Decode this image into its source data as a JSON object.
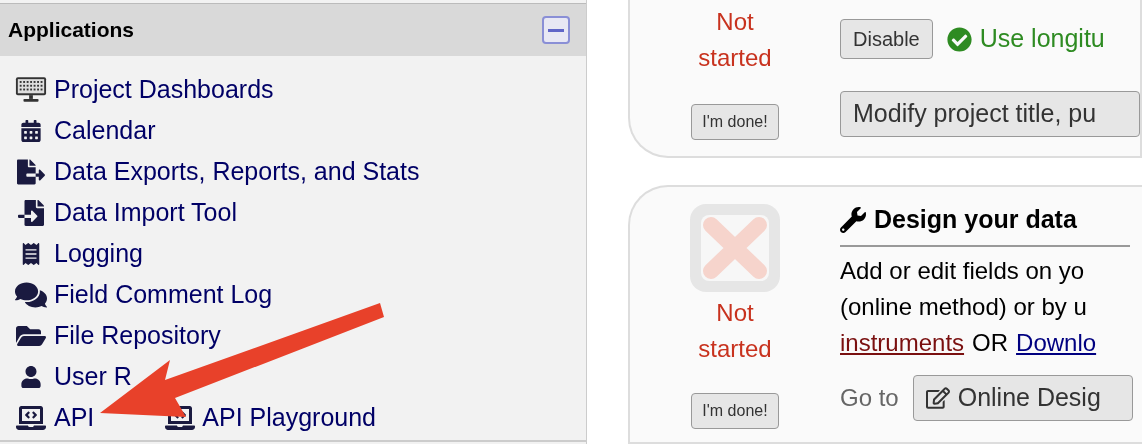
{
  "sidebar": {
    "title": "Applications",
    "collapsed": false,
    "items": [
      {
        "kind": "link",
        "label": "Project Dashboards"
      },
      {
        "kind": "link",
        "label": "Calendar"
      },
      {
        "kind": "link",
        "label": "Data Exports, Reports, and Stats"
      },
      {
        "kind": "link",
        "label": "Data Import Tool"
      },
      {
        "kind": "link",
        "label": "Logging"
      },
      {
        "kind": "link",
        "label": "Field Comment Log"
      },
      {
        "kind": "link",
        "label": "File Repository"
      },
      {
        "kind": "link",
        "label": "User R"
      },
      {
        "kind": "pair",
        "label": "API",
        "label2": "API Playground"
      }
    ]
  },
  "cards": [
    {
      "status": "Not started",
      "done_button": "I'm done!",
      "toggle_button": "Disable",
      "enabled_note": "Use longitu",
      "action_button": "Modify project title, pu"
    },
    {
      "status": "Not started",
      "done_button": "I'm done!",
      "title": "Design your data",
      "description": "Add or edit fields on yo\n(online method) or by u",
      "link1": "instruments",
      "joiner": "OR",
      "link2": "Downlo",
      "goto_label": "Go to",
      "action_button": "Online Desig"
    }
  ],
  "annotation": {
    "kind": "arrow"
  }
}
